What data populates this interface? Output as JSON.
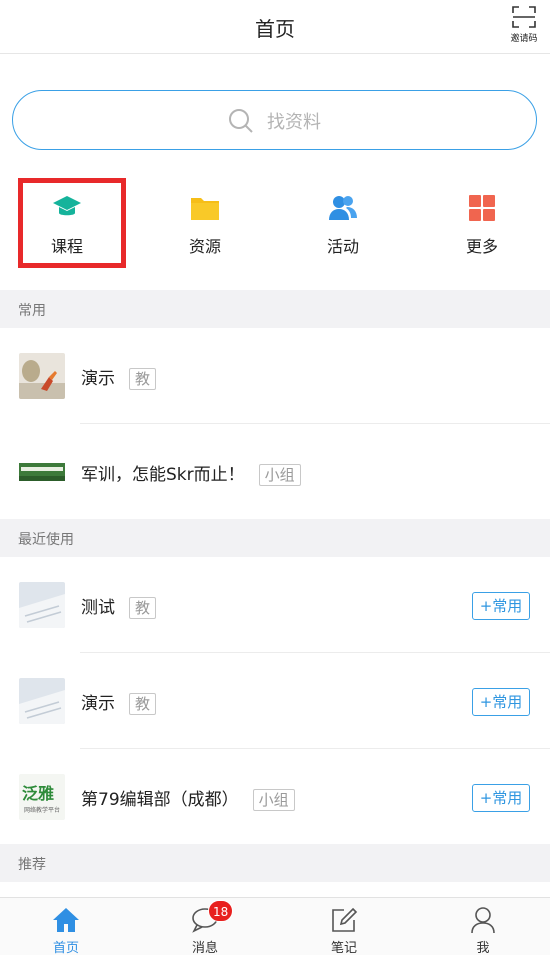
{
  "header": {
    "title": "首页",
    "invite_label": "邀请码"
  },
  "search": {
    "placeholder": "找资料"
  },
  "quick": [
    {
      "label": "课程",
      "icon": "graduation-cap-icon",
      "color": "#15b39b"
    },
    {
      "label": "资源",
      "icon": "folder-icon",
      "color": "#f6be18"
    },
    {
      "label": "活动",
      "icon": "people-icon",
      "color": "#2f8fe3"
    },
    {
      "label": "更多",
      "icon": "grid-icon",
      "color": "#f0654f"
    }
  ],
  "sections": {
    "common": "常用",
    "recent": "最近使用",
    "recommend": "推荐"
  },
  "common": [
    {
      "title": "演示",
      "tag": "教"
    },
    {
      "title": "军训，怎能Skr而止！",
      "tag": "小组"
    }
  ],
  "recent": [
    {
      "title": "测试",
      "tag": "教",
      "action": "+常用"
    },
    {
      "title": "演示",
      "tag": "教",
      "action": "+常用"
    },
    {
      "title": "第79编辑部（成都）",
      "tag": "小组",
      "action": "+常用"
    }
  ],
  "thumb_text": {
    "fanya_logo": "泛雅",
    "fanya_sub": "网络教学平台"
  },
  "tabbar": [
    {
      "label": "首页",
      "icon": "home-icon",
      "active": true
    },
    {
      "label": "消息",
      "icon": "message-icon",
      "badge": "18"
    },
    {
      "label": "笔记",
      "icon": "note-icon"
    },
    {
      "label": "我",
      "icon": "user-icon"
    }
  ],
  "colors": {
    "accent": "#2f8fe3",
    "highlight": "#e8292a",
    "badge": "#e8201e"
  }
}
